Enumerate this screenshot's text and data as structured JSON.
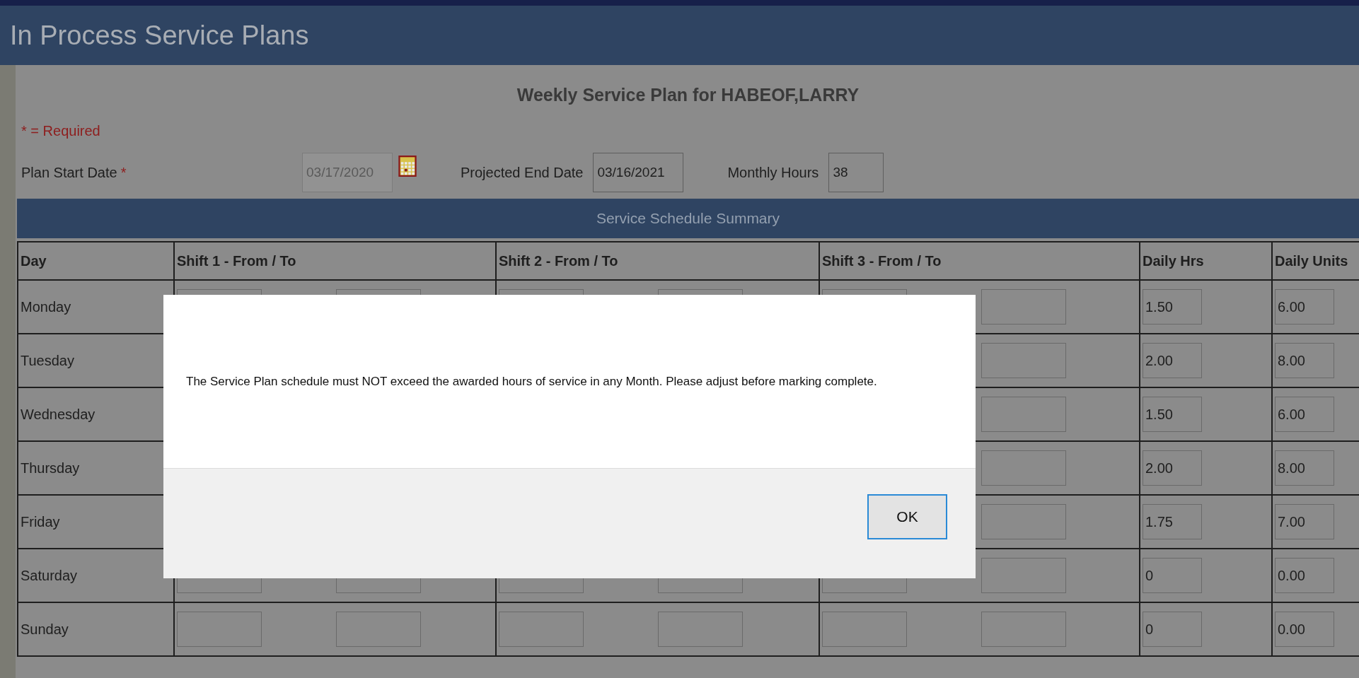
{
  "page_title": "In Process Service Plans",
  "plan_heading": "Weekly Service Plan for HABEOF,LARRY",
  "required_note": "* = Required",
  "fields": [
    {
      "kind": "date-picker",
      "label": "Plan Start Date",
      "required_mark": "*",
      "value": "03/17/2020",
      "disabled": true
    },
    {
      "kind": "text",
      "label": "Projected End Date",
      "value": "03/16/2021",
      "disabled": false
    },
    {
      "kind": "text",
      "label": "Monthly Hours",
      "value": "38",
      "disabled": false
    }
  ],
  "section_title": "Service Schedule Summary",
  "table": {
    "columns": [
      "Day",
      "Shift 1 - From / To",
      "Shift 2 - From / To",
      "Shift 3 - From / To",
      "Daily Hrs",
      "Daily Units"
    ],
    "rows": [
      {
        "day": "Monday",
        "daily_hrs": "1.50",
        "daily_units": "6.00"
      },
      {
        "day": "Tuesday",
        "daily_hrs": "2.00",
        "daily_units": "8.00"
      },
      {
        "day": "Wednesday",
        "daily_hrs": "1.50",
        "daily_units": "6.00"
      },
      {
        "day": "Thursday",
        "daily_hrs": "2.00",
        "daily_units": "8.00"
      },
      {
        "day": "Friday",
        "daily_hrs": "1.75",
        "daily_units": "7.00"
      },
      {
        "day": "Saturday",
        "daily_hrs": "0",
        "daily_units": "0.00"
      },
      {
        "day": "Sunday",
        "daily_hrs": "0",
        "daily_units": "0.00"
      }
    ]
  },
  "dialog": {
    "message": "The Service Plan schedule must NOT exceed the awarded hours of service in any Month. Please adjust before marking complete.",
    "buttons": [
      {
        "label": "OK",
        "focused": true
      }
    ]
  }
}
